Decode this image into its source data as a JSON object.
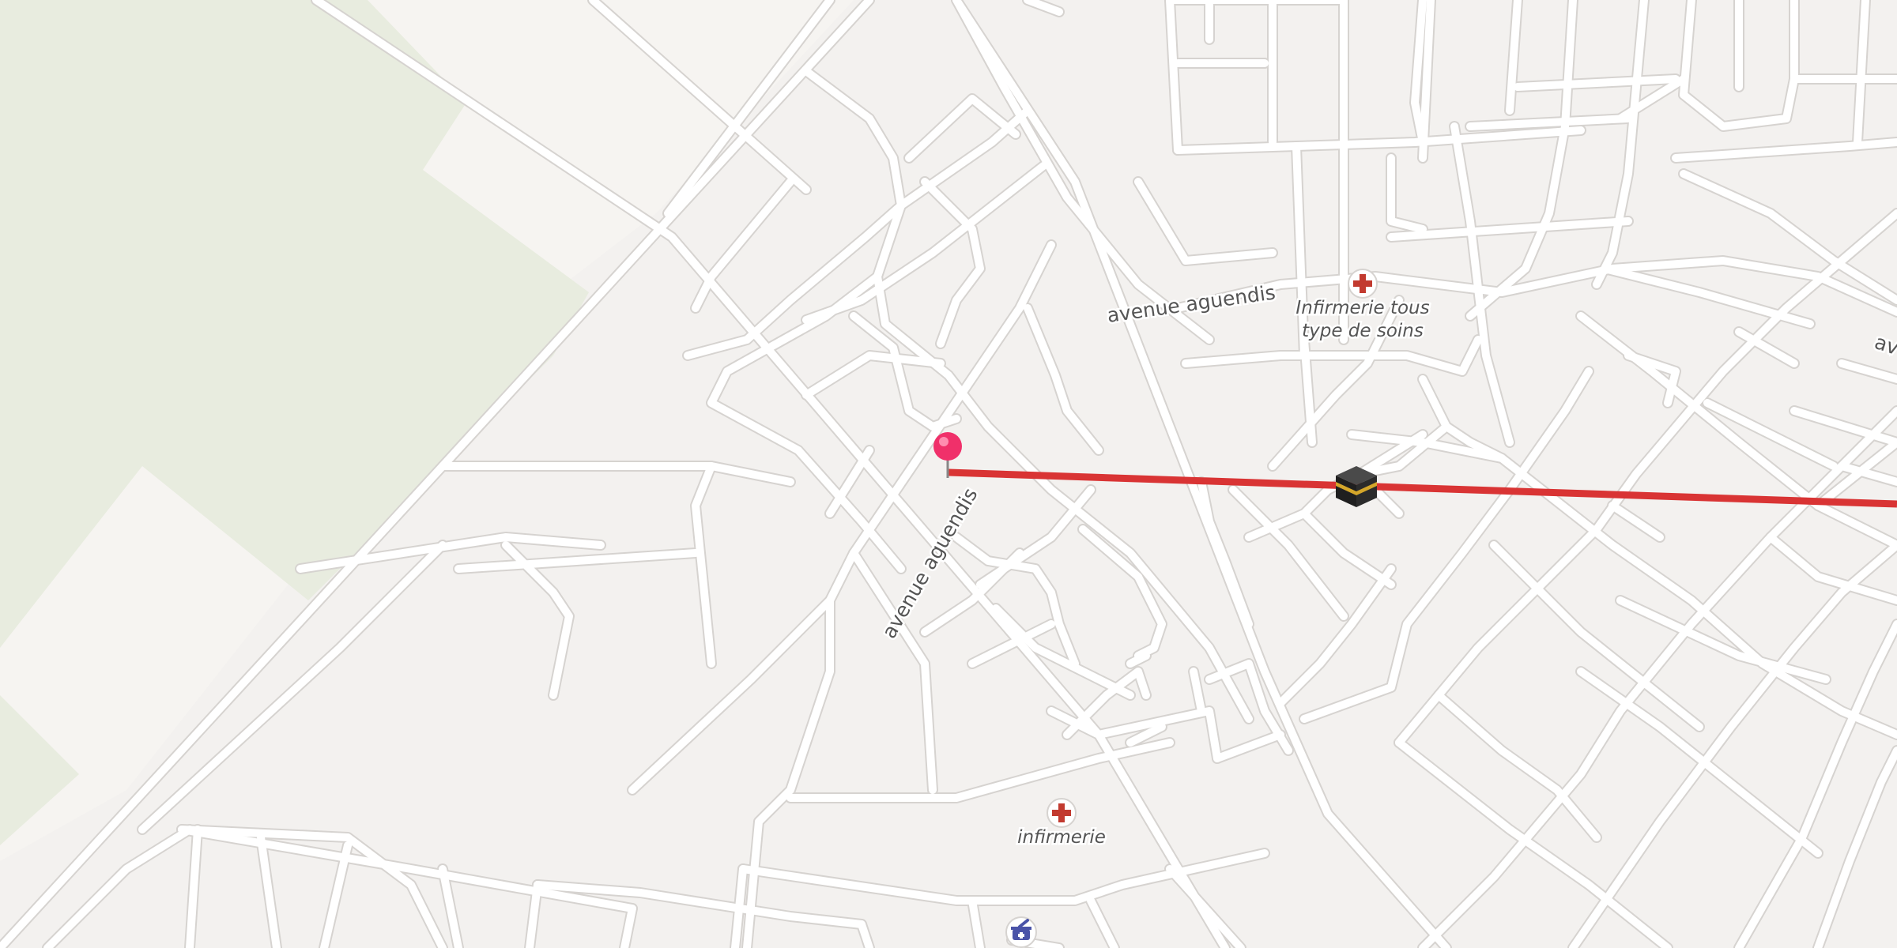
{
  "map": {
    "colors": {
      "land": "#f3f1ef",
      "park": "#e8ecdf",
      "sand": "#f6f4f1",
      "road": "#ffffff",
      "road_casing": "#d6d3d0",
      "route_line": "#d93434",
      "pin": "#f0306a",
      "pharmacy_badge": "#4a53a8",
      "medical_cross": "#c23a2f"
    },
    "street_labels": [
      {
        "text": "avenue aguendis"
      },
      {
        "text": "avenue aguendis"
      },
      {
        "text": "av"
      }
    ],
    "pois": [
      {
        "type": "medical",
        "icon": "medical-cross-icon",
        "label_line1": "Infirmerie tous",
        "label_line2": "type de soins"
      },
      {
        "type": "medical",
        "icon": "medical-cross-icon",
        "label_line1": "infirmerie",
        "label_line2": ""
      },
      {
        "type": "pharmacy",
        "icon": "pharmacy-mortar-icon",
        "label_line1": "",
        "label_line2": ""
      }
    ],
    "markers": {
      "pin_icon": "map-pin-icon",
      "kaaba_icon": "kaaba-icon"
    },
    "route": {
      "description_icon": "qibla-direction-line"
    }
  }
}
